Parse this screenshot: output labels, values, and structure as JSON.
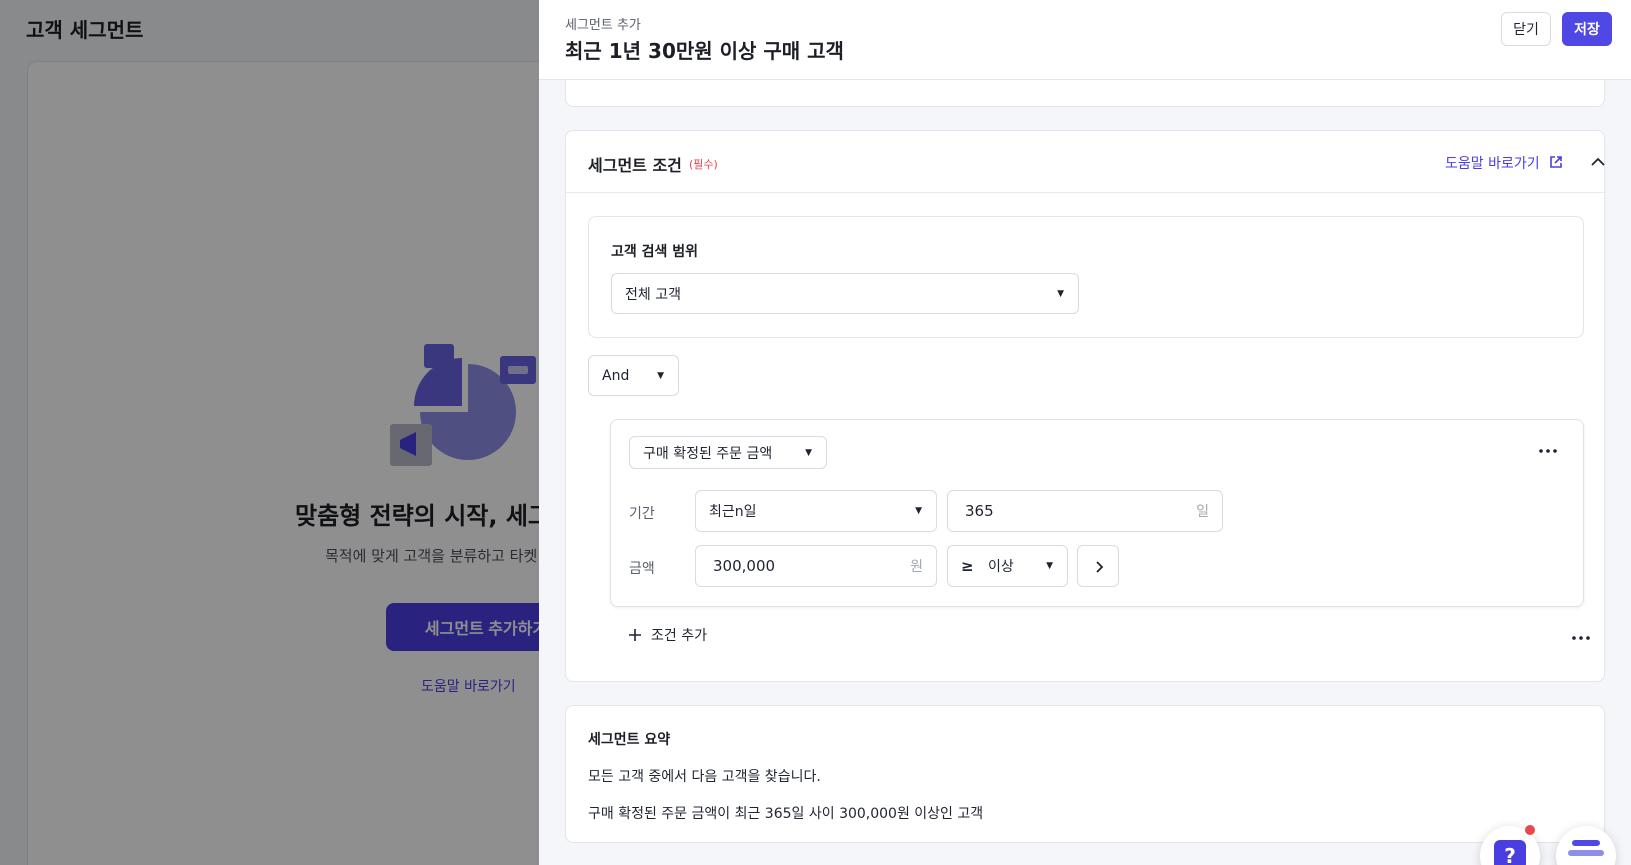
{
  "background": {
    "page_title": "고객 세그먼트",
    "heading": "맞춤형 전략의 시작, 세그",
    "description": "목적에 맞게 고객을 분류하고 타켓",
    "add_button": "세그먼트 추가하기",
    "help_link": "도움말 바로가기"
  },
  "drawer": {
    "subtitle": "세그먼트 추가",
    "title": "최근 1년 30만원 이상 구매 고객",
    "close_label": "닫기",
    "save_label": "저장"
  },
  "conditions": {
    "title": "세그먼트 조건",
    "required": "(필수)",
    "help_link": "도움말 바로가기",
    "scope": {
      "label": "고객 검색 범위",
      "selected": "전체 고객"
    },
    "logic_operator": "And",
    "group": {
      "metric": "구매 확정된 주문 금액",
      "period_label": "기간",
      "period_type": "최근n일",
      "period_value": "365",
      "period_unit": "일",
      "amount_label": "금액",
      "amount_value": "300,000",
      "amount_unit": "원",
      "comparator_symbol": "≥",
      "comparator_label": "이상"
    },
    "add_condition": "조건 추가"
  },
  "summary": {
    "title": "세그먼트 요약",
    "line1": "모든 고객 중에서 다음 고객을 찾습니다.",
    "line2": "구매 확정된 주문 금액이 최근 365일 사이 300,000원 이상인 고객"
  },
  "colors": {
    "accent": "#5048e5",
    "link": "#4a3ee0",
    "required": "#e5484d"
  }
}
